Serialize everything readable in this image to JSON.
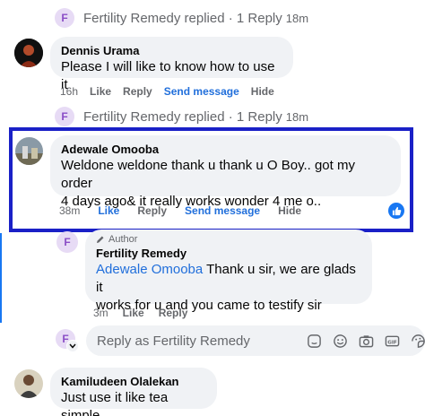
{
  "thread1": {
    "reply_summary": "Fertility Remedy replied · 1 Reply",
    "time": "18m",
    "avatar_letter": "F"
  },
  "comment_dennis": {
    "name": "Dennis Urama",
    "text": "Please I will like to know how to use it",
    "time": "16h",
    "like": "Like",
    "reply": "Reply",
    "send": "Send message",
    "hide": "Hide"
  },
  "thread2": {
    "reply_summary": "Fertility Remedy replied · 1 Reply",
    "time": "18m",
    "avatar_letter": "F"
  },
  "comment_adewale": {
    "name": "Adewale Omooba",
    "text_line1": "Weldone weldone thank u thank u O Boy.. got my order",
    "text_line2": "4 days ago& it really works wonder 4 me o..",
    "time": "38m",
    "like": "Like",
    "reply": "Reply",
    "send": "Send message",
    "hide": "Hide"
  },
  "reply_fertility": {
    "avatar_letter": "F",
    "author_label": "Author",
    "name": "Fertility Remedy",
    "mention": "Adewale Omooba",
    "text_line1_rest": " Thank u sir, we are glads it",
    "text_line2": "works for u and you came to testify sir",
    "time": "3m",
    "like": "Like",
    "reply": "Reply"
  },
  "reply_input": {
    "avatar_letter": "F",
    "placeholder": "Reply as Fertility Remedy"
  },
  "comment_kamil": {
    "name": "Kamiludeen Olalekan",
    "text": "Just use it like tea simple"
  },
  "colors": {
    "highlight": "#1a20c7",
    "link": "#216fdb",
    "fb_blue": "#1877f2"
  },
  "icons": [
    "sticker-icon",
    "emoji-icon",
    "camera-icon",
    "gif-icon",
    "sticker-face-icon"
  ]
}
